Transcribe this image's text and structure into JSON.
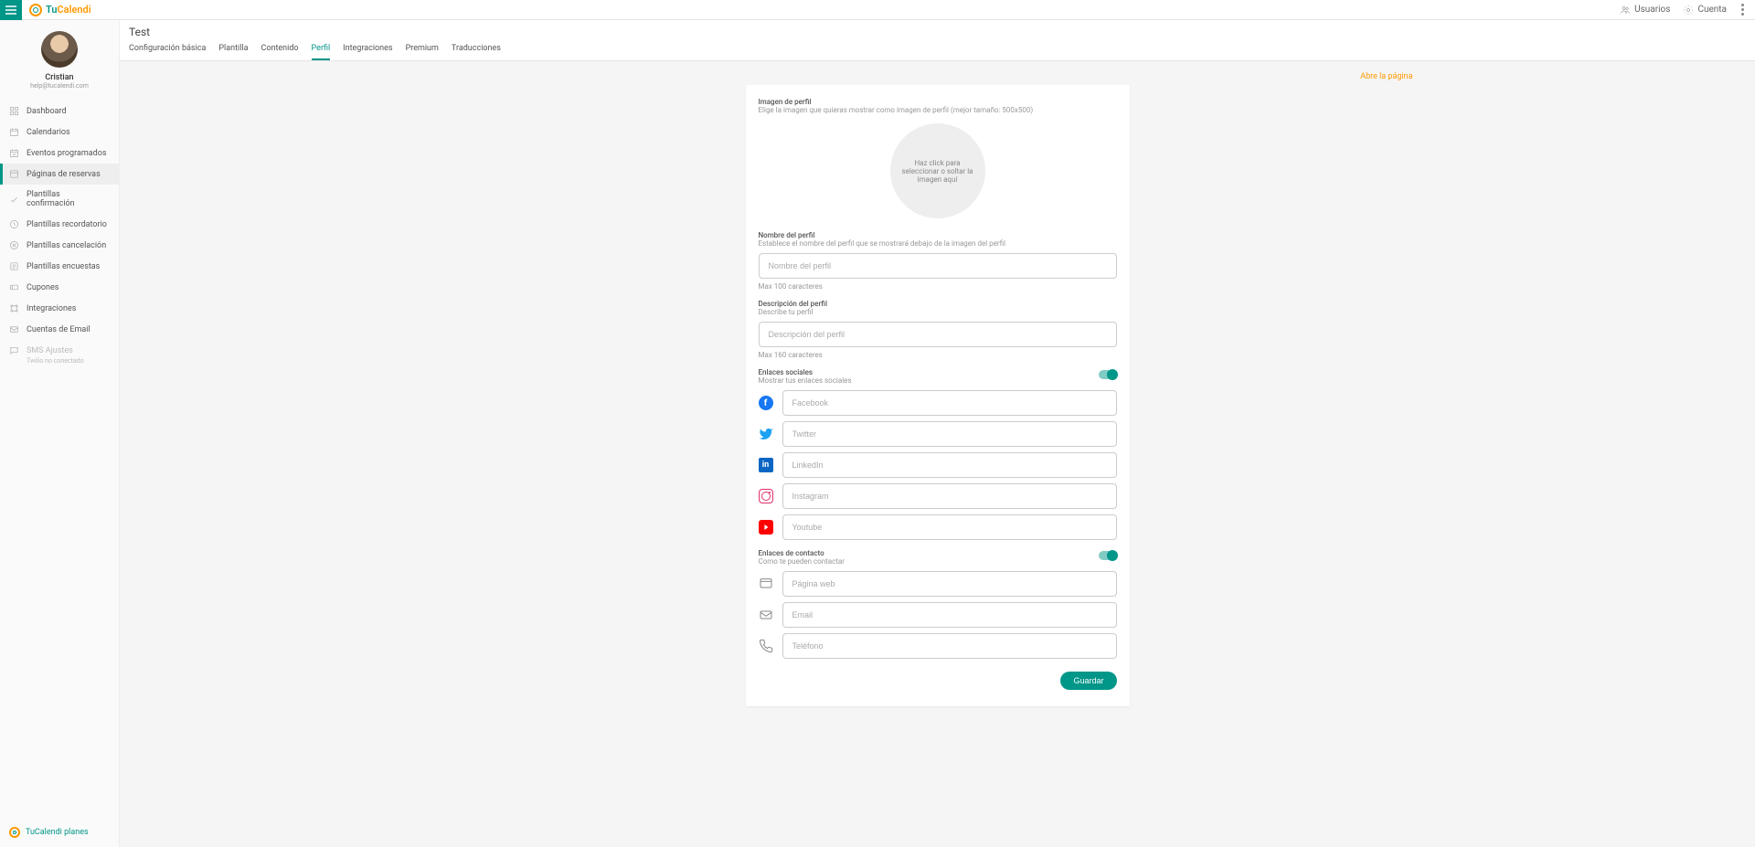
{
  "topbar": {
    "brand_tu": "Tu",
    "brand_calendi": "Calendi",
    "users": "Usuarios",
    "account": "Cuenta"
  },
  "user": {
    "name": "Cristian",
    "email": "help@tucalendi.com"
  },
  "sidebar": {
    "items": [
      {
        "label": "Dashboard"
      },
      {
        "label": "Calendarios"
      },
      {
        "label": "Eventos programados"
      },
      {
        "label": "Páginas de reservas"
      },
      {
        "label": "Plantillas confirmación"
      },
      {
        "label": "Plantillas recordatorio"
      },
      {
        "label": "Plantillas cancelación"
      },
      {
        "label": "Plantillas encuestas"
      },
      {
        "label": "Cupones"
      },
      {
        "label": "Integraciones"
      },
      {
        "label": "Cuentas de Email"
      },
      {
        "label": "SMS Ajustes"
      }
    ],
    "sms_sub": "Twilio no conectado",
    "footer": "TuCalendi planes"
  },
  "page": {
    "title": "Test",
    "tabs": [
      "Configuración básica",
      "Plantilla",
      "Contenido",
      "Perfil",
      "Integraciones",
      "Premium",
      "Traducciones"
    ],
    "open_link": "Abre la página"
  },
  "form": {
    "image_title": "Imagen de perfil",
    "image_desc": "Elige la imagen que quieras mostrar como imagen de perfil (mejor tamaño: 500x500)",
    "dropzone": "Haz click para seleccionar o soltar la imagen aquí",
    "name_title": "Nombre del perfil",
    "name_desc": "Establece el nombre del perfil que se mostrará debajo de la imagen del perfil",
    "name_placeholder": "Nombre del perfil",
    "name_hint": "Max 100 caracteres",
    "desc_title": "Descripción del perfil",
    "desc_desc": "Describe tu perfil",
    "desc_placeholder": "Descripción del perfil",
    "desc_hint": "Max 160 caracteres",
    "social_title": "Enlaces sociales",
    "social_desc": "Mostrar tus enlaces sociales",
    "social": {
      "facebook": "Facebook",
      "twitter": "Twitter",
      "linkedin": "LinkedIn",
      "instagram": "Instagram",
      "youtube": "Youtube"
    },
    "contact_title": "Enlaces de contacto",
    "contact_desc": "Como te pueden contactar",
    "contact": {
      "web": "Página web",
      "email": "Email",
      "phone": "Teléfono"
    },
    "save": "Guardar"
  }
}
